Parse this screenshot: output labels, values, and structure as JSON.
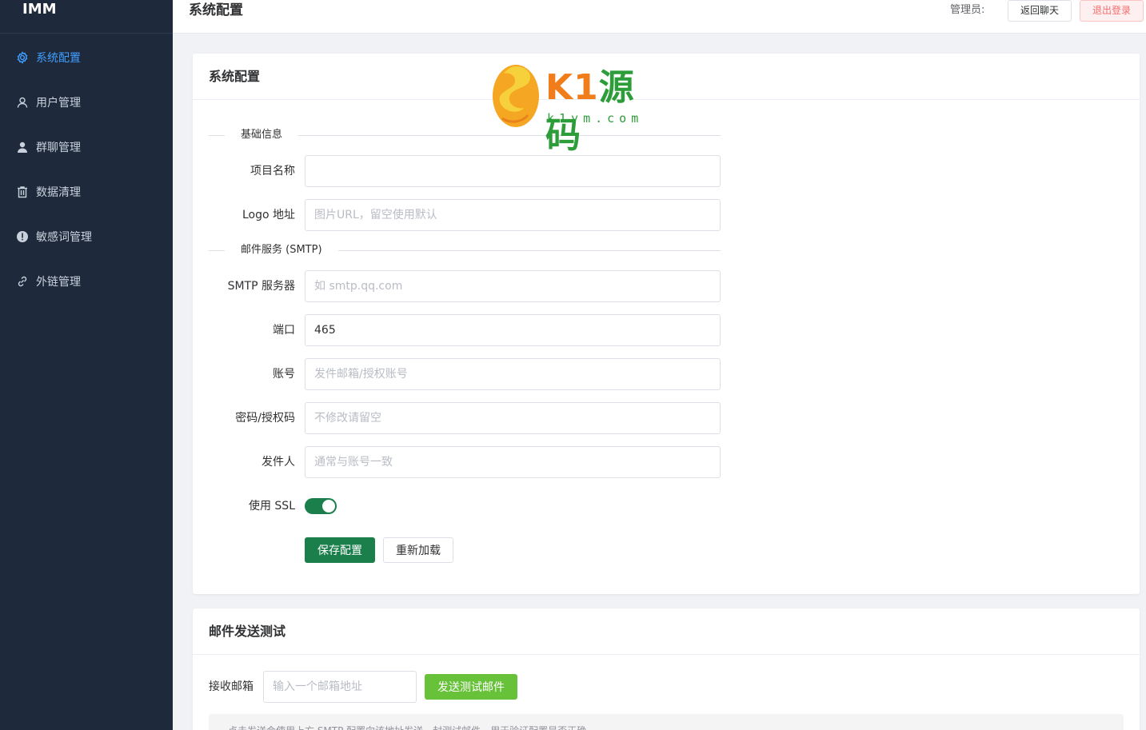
{
  "brand": {
    "name": "IMM"
  },
  "sidebar": {
    "items": [
      {
        "label": "系统配置",
        "icon": "gear-icon",
        "active": true
      },
      {
        "label": "用户管理",
        "icon": "user-icon",
        "active": false
      },
      {
        "label": "群聊管理",
        "icon": "user-filled-icon",
        "active": false
      },
      {
        "label": "数据清理",
        "icon": "trash-icon",
        "active": false
      },
      {
        "label": "敏感词管理",
        "icon": "warning-icon",
        "active": false
      },
      {
        "label": "外链管理",
        "icon": "link-icon",
        "active": false
      }
    ]
  },
  "header": {
    "title": "系统配置",
    "admin_label": "管理员:",
    "back_chat": "返回聊天",
    "logout": "退出登录"
  },
  "watermark": {
    "text_orange": "K1",
    "text_green": "源码",
    "domain": "k1ym.com"
  },
  "config": {
    "title": "系统配置",
    "section_basic": "基础信息",
    "project_name": {
      "label": "项目名称",
      "value": "",
      "placeholder": ""
    },
    "logo_url": {
      "label": "Logo 地址",
      "value": "",
      "placeholder": "图片URL，留空使用默认"
    },
    "section_smtp": "邮件服务 (SMTP)",
    "smtp_server": {
      "label": "SMTP 服务器",
      "value": "",
      "placeholder": "如 smtp.qq.com"
    },
    "port": {
      "label": "端口",
      "value": "465",
      "placeholder": ""
    },
    "account": {
      "label": "账号",
      "value": "",
      "placeholder": "发件邮箱/授权账号"
    },
    "password": {
      "label": "密码/授权码",
      "value": "",
      "placeholder": "不修改请留空"
    },
    "sender": {
      "label": "发件人",
      "value": "",
      "placeholder": "通常与账号一致"
    },
    "ssl": {
      "label": "使用 SSL",
      "enabled": true
    },
    "save": "保存配置",
    "reload": "重新加载"
  },
  "mail_test": {
    "title": "邮件发送测试",
    "recipient_label": "接收邮箱",
    "recipient_placeholder": "输入一个邮箱地址",
    "send": "发送测试邮件",
    "hint": "点击发送会使用上方 SMTP 配置向该地址发送一封测试邮件，用于验证配置是否正确。"
  },
  "colors": {
    "sidebar_bg": "#1e2a3b",
    "active": "#409eff",
    "primary": "#1a7f4b",
    "success": "#67c23a",
    "danger": "#f56c6c"
  }
}
